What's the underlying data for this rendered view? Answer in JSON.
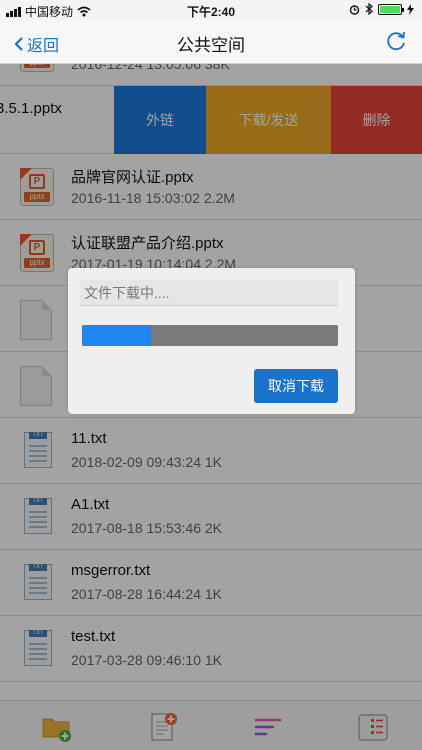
{
  "status_bar": {
    "carrier": "中国移动",
    "time": "下午2:40"
  },
  "nav": {
    "back_label": "返回",
    "title": "公共空间"
  },
  "partial_row": {
    "meta": "2016-12-24 13:05:06 38K"
  },
  "swipe_row": {
    "name_fragment": "3.5.1.pptx",
    "actions": {
      "link": "外链",
      "download": "下载/发送",
      "delete": "删除"
    }
  },
  "files": [
    {
      "name": "品牌官网认证.pptx",
      "meta": "2016-11-18 15:03:02 2.2M",
      "type": "pptx"
    },
    {
      "name": "认证联盟产品介绍.pptx",
      "meta": "2017-01-19 10:14:04 2.2M",
      "type": "pptx"
    },
    {
      "name": "",
      "meta": "",
      "type": "doc"
    },
    {
      "name": "",
      "meta": "",
      "type": "doc"
    },
    {
      "name": "11.txt",
      "meta": "2018-02-09 09:43:24 1K",
      "type": "txt"
    },
    {
      "name": "A1.txt",
      "meta": "2017-08-18 15:53:46 2K",
      "type": "txt"
    },
    {
      "name": "msgerror.txt",
      "meta": "2017-08-28 16:44:24 1K",
      "type": "txt"
    },
    {
      "name": "test.txt",
      "meta": "2017-03-28 09:46:10 1K",
      "type": "txt"
    }
  ],
  "icon_labels": {
    "ppt_badge": "pptx",
    "ppt_letter": "P",
    "txt_tag": "TXT"
  },
  "dialog": {
    "placeholder": "文件下载中....",
    "progress": 0.27,
    "cancel_label": "取消下载"
  },
  "tabbar": {
    "tabs": [
      {
        "icon": "folder-add-icon"
      },
      {
        "icon": "new-document-icon"
      },
      {
        "icon": "sort-icon"
      },
      {
        "icon": "list-menu-icon"
      }
    ]
  },
  "colors": {
    "accent": "#1a73c9",
    "link_action": "#1f78d8",
    "download_action": "#f0a826",
    "delete_action": "#e8423a",
    "progress_fill": "#1f86f0"
  }
}
